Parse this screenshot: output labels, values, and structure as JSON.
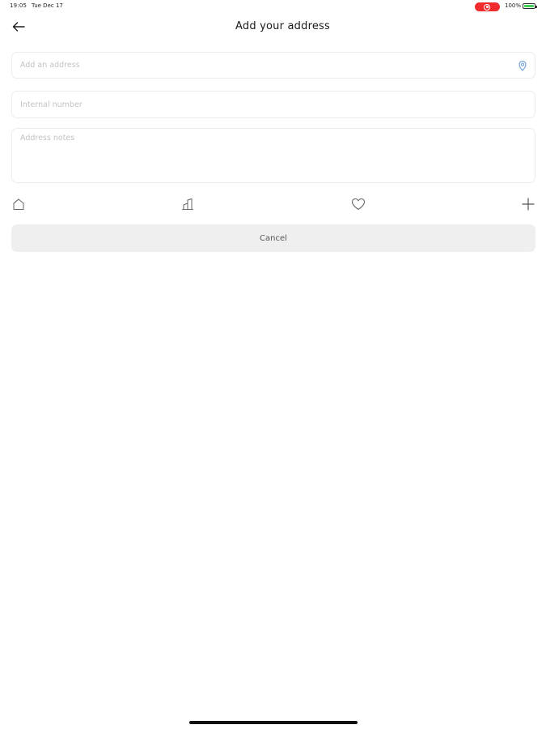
{
  "status_bar": {
    "time": "19:05",
    "date": "Tue Dec 17",
    "battery_percent": "100%",
    "battery_level": 1.0,
    "recording_color": "#ef2b2b",
    "battery_color": "#3ed152"
  },
  "header": {
    "title": "Add your address",
    "back_icon": "arrow-left-icon"
  },
  "form": {
    "address": {
      "value": "",
      "placeholder": "Add an address",
      "icon": "location-pin-icon",
      "icon_color": "#6a9bd8"
    },
    "internal_number": {
      "value": "",
      "placeholder": "Internal number"
    },
    "address_notes": {
      "value": "",
      "placeholder": "Address notes"
    }
  },
  "label_icons": [
    {
      "name": "home-icon"
    },
    {
      "name": "building-icon"
    },
    {
      "name": "heart-icon"
    },
    {
      "name": "plus-icon"
    }
  ],
  "actions": {
    "cancel_label": "Cancel"
  }
}
